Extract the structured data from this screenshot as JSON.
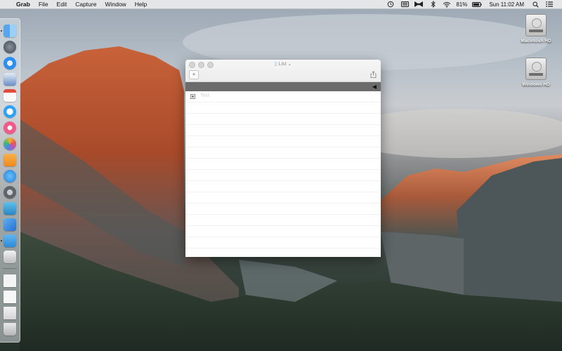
{
  "menubar": {
    "apple_glyph": "",
    "app_name": "Grab",
    "menus": [
      "File",
      "Edit",
      "Capture",
      "Window",
      "Help"
    ],
    "battery_percent": "81%",
    "clock": "Sun 11:02 AM",
    "status_icons": [
      "time-machine-icon",
      "keyboard-layout-icon",
      "bowtie-icon",
      "bluetooth-icon",
      "wifi-icon",
      "battery-icon",
      "search-icon",
      "notification-center-icon"
    ]
  },
  "desktop": {
    "disks": [
      {
        "label": "Macintosh HD"
      },
      {
        "label": "Windows HD"
      }
    ]
  },
  "dock": {
    "apps": [
      {
        "name": "finder-icon",
        "color": "#3b8de0"
      },
      {
        "name": "launchpad-icon",
        "color": "#4a5560"
      },
      {
        "name": "safari-icon",
        "color": "#2b8ef0"
      },
      {
        "name": "mail-icon",
        "color": "#6b8fc7"
      },
      {
        "name": "calendar-icon",
        "color": "#f4f4f4"
      },
      {
        "name": "messages-icon",
        "color": "#2ea1f2"
      },
      {
        "name": "itunes-icon",
        "color": "#f05b8c"
      },
      {
        "name": "photos-icon",
        "color": "#f2b233"
      },
      {
        "name": "ibooks-icon",
        "color": "#f39a27"
      },
      {
        "name": "app-store-icon",
        "color": "#1f8df0"
      },
      {
        "name": "system-preferences-icon",
        "color": "#6f7378"
      },
      {
        "name": "tweetbot-icon",
        "color": "#3aa8d8"
      },
      {
        "name": "xcode-icon",
        "color": "#3a8ee6"
      },
      {
        "name": "list-app-icon",
        "color": "#3ea0e8"
      },
      {
        "name": "preview-icon",
        "color": "#e6e6e6"
      },
      {
        "name": "document-icon",
        "color": "#f1f1f1"
      },
      {
        "name": "textedit-icon",
        "color": "#f5f5f5"
      },
      {
        "name": "downloads-folder-icon",
        "color": "#eaeaea"
      },
      {
        "name": "trash-icon",
        "color": "#d6d6d6"
      }
    ]
  },
  "window": {
    "title": "List",
    "add_label": "+",
    "rows": [
      {
        "text": "Text"
      }
    ]
  }
}
